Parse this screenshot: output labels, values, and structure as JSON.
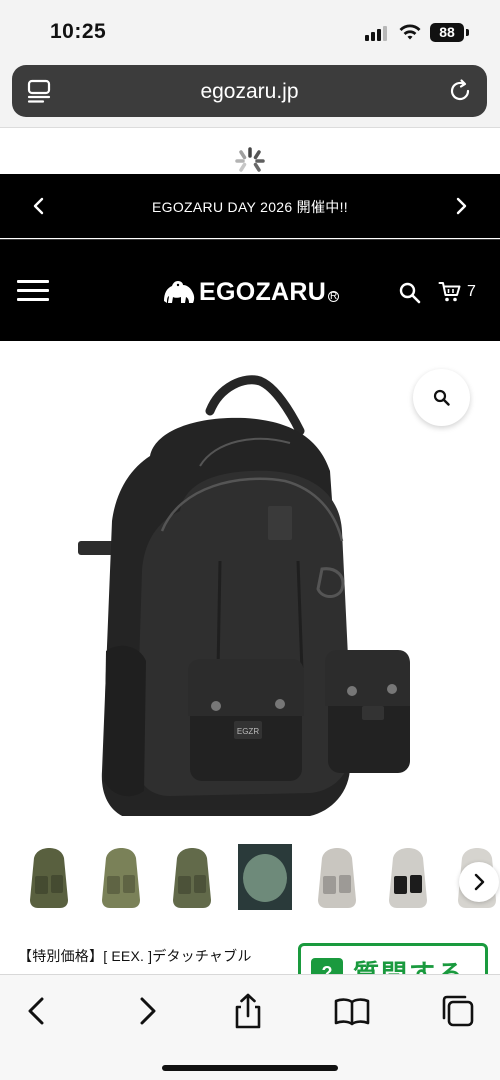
{
  "status_bar": {
    "time": "10:25",
    "battery": "88",
    "icons": [
      "cellular-signal-icon",
      "wifi-icon",
      "battery-icon"
    ]
  },
  "browser": {
    "url": "egozaru.jp",
    "icons": [
      "tab-overview-icon",
      "reload-icon",
      "loading-spinner-icon"
    ]
  },
  "announcement": {
    "text": "EGOZARU DAY 2026 開催中!!",
    "icons": [
      "chevron-left-icon",
      "chevron-right-icon"
    ]
  },
  "site_header": {
    "logo_text": "EGOZARU",
    "logo_reg": "R",
    "cart_count": "7",
    "icons": [
      "menu-icon",
      "gorilla-logo-icon",
      "search-icon",
      "cart-icon"
    ]
  },
  "product": {
    "image_icon": "backpack-icon",
    "zoom_icon": "zoom-icon",
    "badge_text": "EGZR",
    "title": "【特別価格】[ EEX. ]デタッチャブル",
    "thumbnails": [
      {
        "name": "olive-front",
        "color": "#59603f"
      },
      {
        "name": "olive-angle",
        "color": "#7a8158"
      },
      {
        "name": "olive-back",
        "color": "#626a4a"
      },
      {
        "name": "olive-detail",
        "color": "#6e8a7a"
      },
      {
        "name": "gray-front",
        "color": "#c9c6c0"
      },
      {
        "name": "gray-black-pockets",
        "color": "#cfcdc8"
      },
      {
        "name": "gray-side",
        "color": "#d6d4cf"
      }
    ]
  },
  "ask_button": {
    "badge": "?",
    "label": "質問する"
  },
  "toolbar": {
    "icons": [
      "back-icon",
      "forward-icon",
      "share-icon",
      "bookmarks-icon",
      "tabs-icon"
    ]
  },
  "colors": {
    "header_bg": "#000000",
    "accent_green": "#1a9a3e",
    "backpack_body": "#2b2b2b"
  }
}
